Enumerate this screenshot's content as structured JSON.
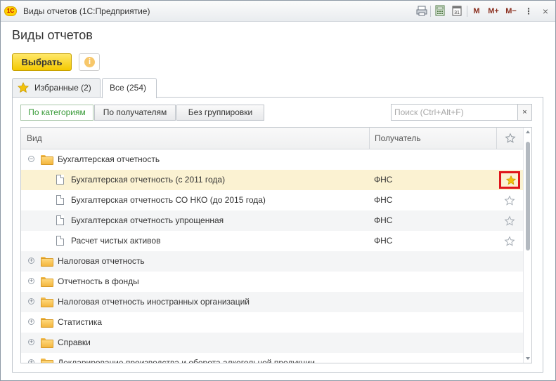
{
  "window": {
    "logo": "1С",
    "title": "Виды отчетов  (1С:Предприятие)",
    "toolbar": {
      "mem_m": "M",
      "mem_plus": "M+",
      "mem_minus": "M−",
      "close": "×"
    }
  },
  "page_title": "Виды отчетов",
  "actions": {
    "select_label": "Выбрать",
    "info_symbol": "i"
  },
  "tabs": [
    {
      "label": "Избранные (2)",
      "active": false
    },
    {
      "label": "Все (254)",
      "active": true
    }
  ],
  "grouping": [
    {
      "label": "По категориям",
      "active": true
    },
    {
      "label": "По получателям",
      "active": false
    },
    {
      "label": "Без группировки",
      "active": false
    }
  ],
  "search": {
    "placeholder": "Поиск (Ctrl+Alt+F)",
    "clear": "×"
  },
  "table": {
    "columns": {
      "type": "Вид",
      "recipient": "Получатель"
    },
    "rows": [
      {
        "kind": "group",
        "expanded": true,
        "label": "Бухгалтерская отчетность",
        "recipient": ""
      },
      {
        "kind": "item",
        "label": "Бухгалтерская отчетность (с 2011 года)",
        "recipient": "ФНС",
        "favorite": true,
        "selected": true
      },
      {
        "kind": "item",
        "label": "Бухгалтерская отчетность СО НКО (до 2015 года)",
        "recipient": "ФНС",
        "favorite": false
      },
      {
        "kind": "item",
        "label": "Бухгалтерская отчетность упрощенная",
        "recipient": "ФНС",
        "favorite": false
      },
      {
        "kind": "item",
        "label": "Расчет чистых активов",
        "recipient": "ФНС",
        "favorite": false
      },
      {
        "kind": "group",
        "expanded": false,
        "label": "Налоговая отчетность",
        "recipient": ""
      },
      {
        "kind": "group",
        "expanded": false,
        "label": "Отчетность в фонды",
        "recipient": ""
      },
      {
        "kind": "group",
        "expanded": false,
        "label": "Налоговая отчетность иностранных организаций",
        "recipient": ""
      },
      {
        "kind": "group",
        "expanded": false,
        "label": "Статистика",
        "recipient": ""
      },
      {
        "kind": "group",
        "expanded": false,
        "label": "Справки",
        "recipient": ""
      },
      {
        "kind": "group",
        "expanded": false,
        "label": "Декларирование производства и оборота алкогольной продукции",
        "recipient": ""
      }
    ]
  },
  "colors": {
    "accent_yellow": "#f4c900",
    "active_green": "#3a9b3a",
    "favorite_star": "#f2c20d",
    "highlight_red": "#e0161b",
    "selected_row": "#fbf2d2"
  }
}
